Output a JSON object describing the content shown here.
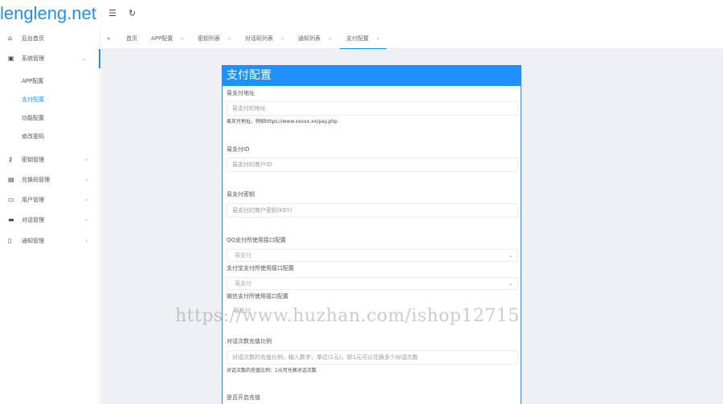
{
  "header": {
    "logo": "lengleng.net",
    "menu_icon": "menu-icon",
    "refresh_icon": "refresh-icon"
  },
  "sidebar": {
    "items": [
      {
        "label": "后台首页",
        "icon": "home-icon"
      },
      {
        "label": "系统管理",
        "icon": "system-icon",
        "arrow": "⌄"
      },
      {
        "label": "密钥管理",
        "icon": "key-icon",
        "arrow": "›"
      },
      {
        "label": "兑换码管理",
        "icon": "gift-icon",
        "arrow": "›"
      },
      {
        "label": "用户管理",
        "icon": "user-icon",
        "arrow": "›"
      },
      {
        "label": "对话管理",
        "icon": "chat-icon",
        "arrow": "›"
      },
      {
        "label": "通知管理",
        "icon": "doc-icon",
        "arrow": "›"
      }
    ],
    "subitems": [
      "APP配置",
      "支付配置",
      "功能配置",
      "修改密码"
    ]
  },
  "tabs": {
    "home_icon": "«",
    "items": [
      {
        "label": "首页"
      },
      {
        "label": "APP配置",
        "close": "×"
      },
      {
        "label": "密钥列表",
        "close": "×"
      },
      {
        "label": "对话码列表",
        "close": "×"
      },
      {
        "label": "通知列表",
        "close": "×"
      },
      {
        "label": "支付配置",
        "close": "×"
      }
    ]
  },
  "panel": {
    "title": "支付配置",
    "pay_url_label": "易支付地址",
    "pay_url_placeholder": "易支付的地址",
    "pay_url_hint": "易支付地址，例如https://www.xxxxx.xx/pay.php",
    "pay_id_label": "易支付ID",
    "pay_id_placeholder": "易支付的商户ID",
    "pay_key_label": "易支付密钥",
    "pay_key_placeholder": "易支付的商户密钥(KEY)",
    "qq_label": "QQ支付所使用接口配置",
    "qq_value": "易支付",
    "alipay_label": "支付宝支付所使用接口配置",
    "alipay_value": "易支付",
    "wechat_label": "微信支付所使用接口配置",
    "wechat_value": "易支付",
    "ratio_label": "对话次数充值比例",
    "ratio_placeholder": "对话次数的充值比例，输入数字，单位(1元)，即1元可以兑换多少对话次数",
    "ratio_hint": "对话次数的充值比例：1元可兑换对话次数",
    "recharge_label": "是否开启充值"
  },
  "watermark": "https://www.huzhan.com/ishop12715",
  "colors": {
    "accent": "#1e90ff",
    "content_bg": "#eef0f5"
  }
}
